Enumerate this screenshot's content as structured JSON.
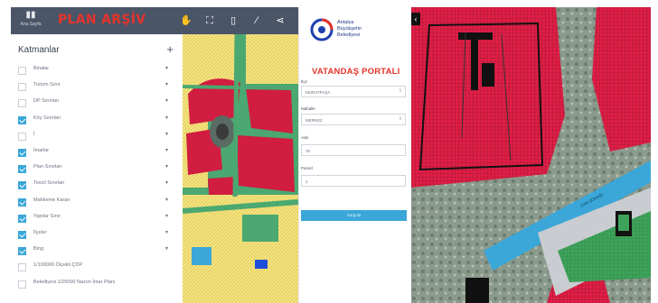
{
  "toolbar": {
    "home_label": "Ana Sayfa",
    "app_title": "PLAN ARŞİV",
    "tools": [
      "hand-icon",
      "extent-icon",
      "delete-icon",
      "measure-icon",
      "share-icon"
    ]
  },
  "layers_panel": {
    "title": "Katmanlar",
    "add_symbol": "+",
    "items": [
      {
        "label": "Binalar",
        "checked": false
      },
      {
        "label": "Turizm Sınır",
        "checked": false
      },
      {
        "label": "DP Sınırları",
        "checked": false
      },
      {
        "label": "Köy Sınırları",
        "checked": true
      },
      {
        "label": "İ",
        "checked": false
      },
      {
        "label": "İmarlar",
        "checked": true
      },
      {
        "label": "Plan Sınırları",
        "checked": true
      },
      {
        "label": "Tescil Sınırları",
        "checked": true
      },
      {
        "label": "Mahkeme Kararı",
        "checked": true
      },
      {
        "label": "Yapılar Sınır",
        "checked": true
      },
      {
        "label": "İlçeler",
        "checked": true
      },
      {
        "label": "Bing",
        "checked": true
      },
      {
        "label": "1/100000 Ölçekli ÇDP",
        "checked": false
      },
      {
        "label": "Belediyesi 1/25000 Nazım İmar Planı",
        "checked": false
      }
    ]
  },
  "portal": {
    "logo_lines": [
      "Antalya",
      "Büyükşehir",
      "Belediyesi"
    ],
    "title": "VATANDAŞ PORTALI",
    "fields": [
      {
        "label": "İlçe",
        "value": "MURATPAŞA",
        "type": "select"
      },
      {
        "label": "Mahalle",
        "value": "MERKEZ",
        "type": "select"
      },
      {
        "label": "Ada",
        "value": "75",
        "type": "input"
      },
      {
        "label": "Parsel",
        "value": "1",
        "type": "input"
      }
    ],
    "query_button": "Sorgula"
  },
  "map": {
    "road_label": "CAN SOKAĞI",
    "colors": {
      "residential": "#e11d48",
      "green_area": "#4aa870",
      "yellow_area": "#f4e27a",
      "road": "#3aa7d8",
      "accent_red": "#e6332a",
      "toolbar": "#4a5568"
    }
  }
}
